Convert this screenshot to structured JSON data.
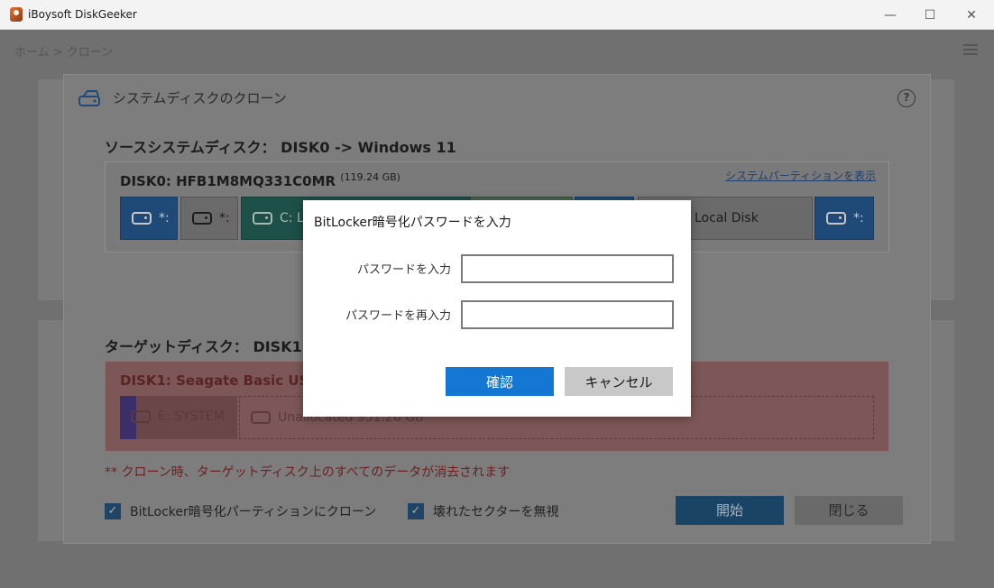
{
  "window": {
    "title": "iBoysoft DiskGeeker",
    "minimize": "—",
    "maximize": "☐",
    "close": "✕"
  },
  "breadcrumb": "ホーム > クローン",
  "clone_dialog": {
    "title": "システムディスクのクローン",
    "help": "?",
    "source_heading": "ソースシステムディスク： DISK0 -> Windows 11",
    "source_disk": {
      "name": "DISK0: HFB1M8MQ331C0MR",
      "size": "(119.24 GB)",
      "show_system_link": "システムパーティションを表示",
      "partitions": [
        {
          "label": "*:",
          "color": "#1f6fc4"
        },
        {
          "label": "*:",
          "color": "#9a9a9a"
        },
        {
          "label": "C: L",
          "color": "#1d7f6f"
        },
        {
          "label": "",
          "color": "#62a07a"
        },
        {
          "label": "",
          "color": "#1f6fc4"
        },
        {
          "label": "Local Disk",
          "color": "#9a9a9a"
        },
        {
          "label": "*:",
          "color": "#1f6fc4"
        }
      ]
    },
    "target_heading": "ターゲットディスク： DISK1",
    "target_disk": {
      "name": "DISK1: Seagate Basic USB",
      "partitions": [
        {
          "label": "E: SYSTEM"
        },
        {
          "label": "Unallocated 931.26 GB"
        }
      ]
    },
    "warning": "** クローン時、ターゲットディスク上のすべてのデータが消去されます",
    "options": {
      "bitlocker_label": "BitLocker暗号化パーティションにクローン",
      "bitlocker_checked": true,
      "ignore_bad_label": "壊れたセクターを無視",
      "ignore_bad_checked": true
    },
    "start_button": "開始",
    "close_button": "閉じる"
  },
  "password_modal": {
    "title": "BitLocker暗号化パスワードを入力",
    "password_label": "パスワードを入力",
    "password_value": "",
    "confirm_label": "パスワードを再入力",
    "confirm_value": "",
    "ok_button": "確認",
    "cancel_button": "キャンセル"
  },
  "colors": {
    "accent": "#1577d4",
    "warning": "#c0392b",
    "target_bg": "#f19a9a"
  }
}
